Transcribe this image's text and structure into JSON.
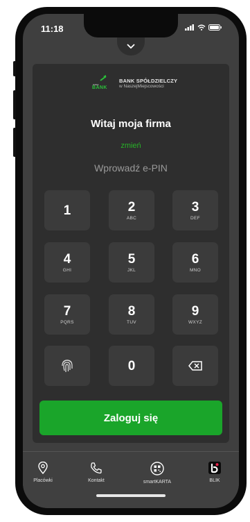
{
  "status": {
    "time": "11:18"
  },
  "bank": {
    "name_line1": "BANK SPÓŁDZIELCZY",
    "name_line2": "w NaszejMiejscowości",
    "mark_line1": "nasz",
    "mark_line2": "BANK"
  },
  "greeting": "Witaj moja firma",
  "change_link": "zmień",
  "pin_prompt": "Wprowadź e-PIN",
  "keypad": [
    {
      "num": "1",
      "letters": ""
    },
    {
      "num": "2",
      "letters": "ABC"
    },
    {
      "num": "3",
      "letters": "DEF"
    },
    {
      "num": "4",
      "letters": "GHI"
    },
    {
      "num": "5",
      "letters": "JKL"
    },
    {
      "num": "6",
      "letters": "MNO"
    },
    {
      "num": "7",
      "letters": "PQRS"
    },
    {
      "num": "8",
      "letters": "TUV"
    },
    {
      "num": "9",
      "letters": "WXYZ"
    },
    {
      "num": "0",
      "letters": ""
    }
  ],
  "login_button": "Zaloguj się",
  "tabs": [
    {
      "label": "Placówki",
      "icon": "location-pin-icon"
    },
    {
      "label": "Kontakt",
      "icon": "phone-icon"
    },
    {
      "label": "smartKARTA",
      "icon": "qr-card-icon"
    },
    {
      "label": "BLIK",
      "icon": "blik-icon"
    }
  ],
  "colors": {
    "accent": "#1aa52a",
    "change_link": "#27b327",
    "background": "#3f3f3f",
    "card": "#2e2e2e",
    "key": "#3b3b3b"
  }
}
